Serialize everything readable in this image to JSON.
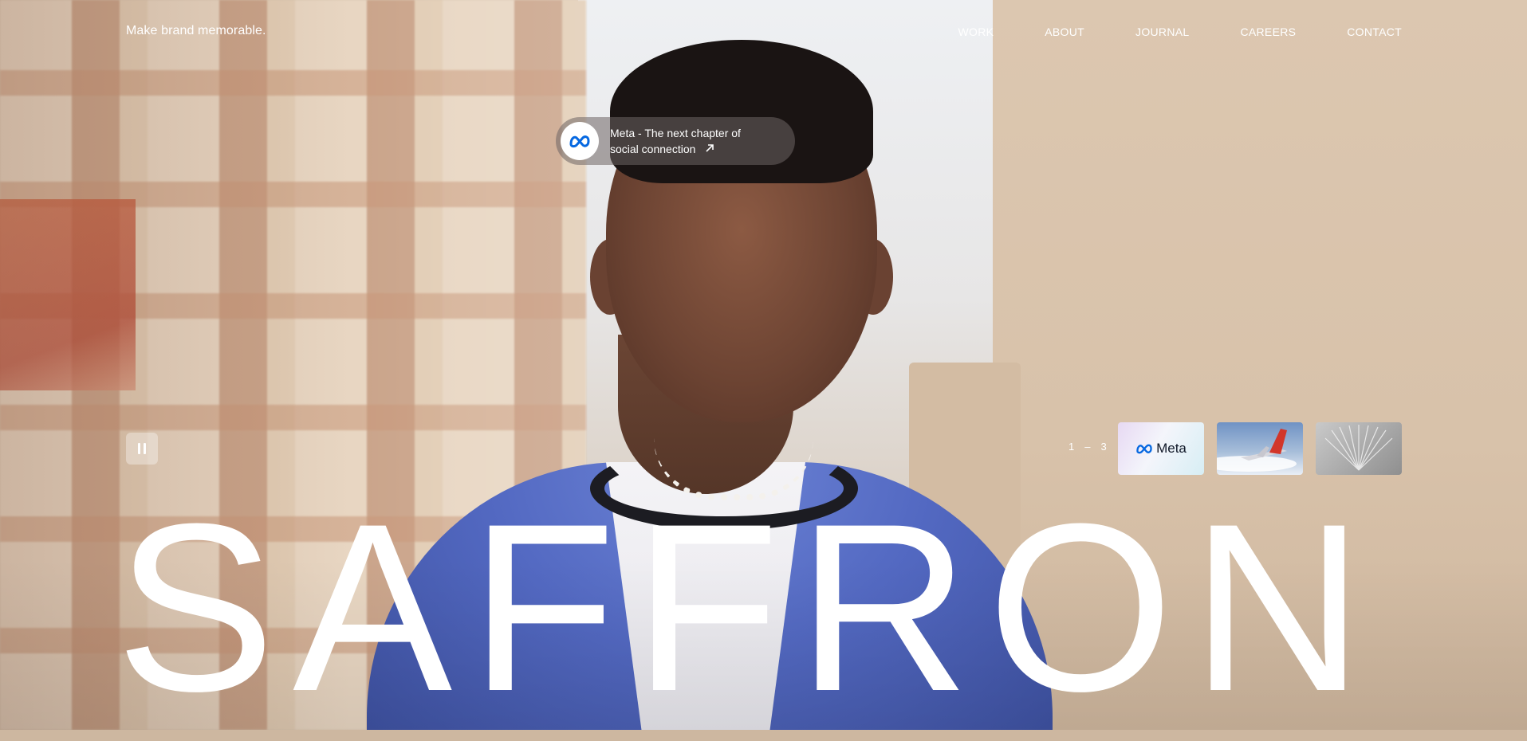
{
  "header": {
    "tagline": "Make brand memorable.",
    "nav": [
      "WORK",
      "ABOUT",
      "JOURNAL",
      "CAREERS",
      "CONTACT"
    ]
  },
  "featured": {
    "line1": "Meta - The next chapter of",
    "line2": "social connection",
    "icon": "meta-logo-icon",
    "arrow_icon": "arrow-up-right-icon"
  },
  "slider": {
    "current": "1",
    "separator": "–",
    "total": "3",
    "thumbnails": [
      {
        "label": "Meta",
        "icon": "meta-logo-icon"
      },
      {
        "label": "",
        "icon": "airplane-image"
      },
      {
        "label": "",
        "icon": "sculpture-image"
      }
    ],
    "pause_icon": "pause-icon"
  },
  "hero": {
    "wordmark": "SAFFRON"
  },
  "colors": {
    "text": "#ffffff",
    "meta_blue": "#0668E1"
  }
}
